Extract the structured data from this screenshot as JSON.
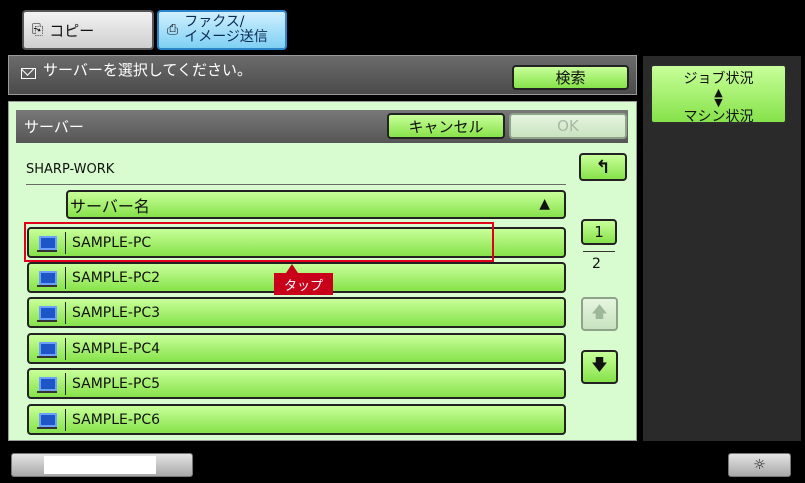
{
  "tabs": {
    "copy_label": "コピー",
    "fax_label_line1": "ファクス/",
    "fax_label_line2": "イメージ送信"
  },
  "message": "サーバーを選択してください。",
  "search_label": "検索",
  "job_status": {
    "line1": "ジョブ状況",
    "line2": "マシン状況"
  },
  "panel": {
    "title": "サーバー",
    "cancel_label": "キャンセル",
    "ok_label": "OK",
    "workgroup": "SHARP-WORK",
    "column_header": "サーバー名",
    "sort_icon": "▲",
    "servers": [
      "SAMPLE-PC",
      "SAMPLE-PC2",
      "SAMPLE-PC3",
      "SAMPLE-PC4",
      "SAMPLE-PC5",
      "SAMPLE-PC6"
    ]
  },
  "tooltip": "タップ",
  "paging": {
    "current": "1",
    "total": "2"
  },
  "colors": {
    "button_green": "#86e24a",
    "highlight_red": "#e0001a",
    "panel_bg": "#d8fbd0"
  }
}
